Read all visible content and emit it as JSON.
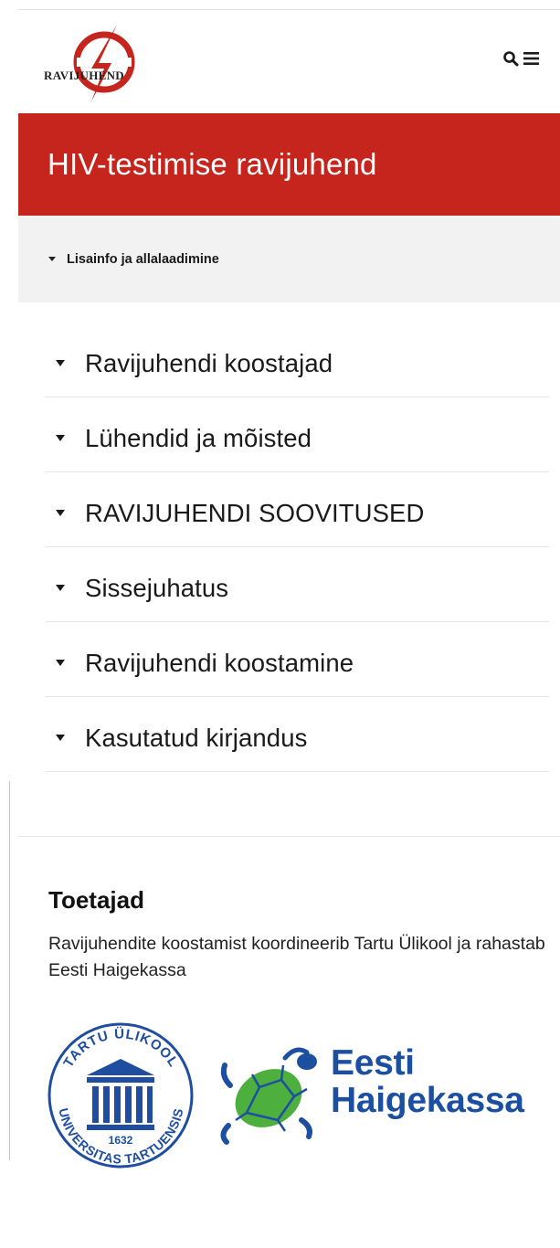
{
  "header": {
    "logo_text": "RAVIJUHEND",
    "icons": [
      "search-icon",
      "menu-icon"
    ]
  },
  "title": "HIV-testimise ravijuhend",
  "info_bar": {
    "label": "Lisainfo ja allalaadimine"
  },
  "toc": {
    "items": [
      {
        "label": "Ravijuhendi koostajad"
      },
      {
        "label": "Lühendid ja mõisted"
      },
      {
        "label": "RAVIJUHENDI SOOVITUSED"
      },
      {
        "label": "Sissejuhatus"
      },
      {
        "label": "Ravijuhendi koostamine"
      },
      {
        "label": "Kasutatud kirjandus"
      }
    ]
  },
  "sponsors": {
    "heading": "Toetajad",
    "text": "Ravijuhendite koostamist koordineerib Tartu Ülikool ja rahastab Eesti Haigekassa",
    "tartu_seal": {
      "top_text": "TARTU ÜLIKOOL",
      "bottom_text": "UNIVERSITAS TARTUENSIS",
      "year": "1632"
    },
    "haigekassa": {
      "line1": "Eesti",
      "line2": "Haigekassa"
    }
  },
  "colors": {
    "banner": "#c5251c",
    "info_bar_bg": "#f2f2f2",
    "tartu_blue": "#1f4ea1",
    "haigekassa_blue": "#1c4fa0",
    "turtle_green": "#4caf3e"
  }
}
